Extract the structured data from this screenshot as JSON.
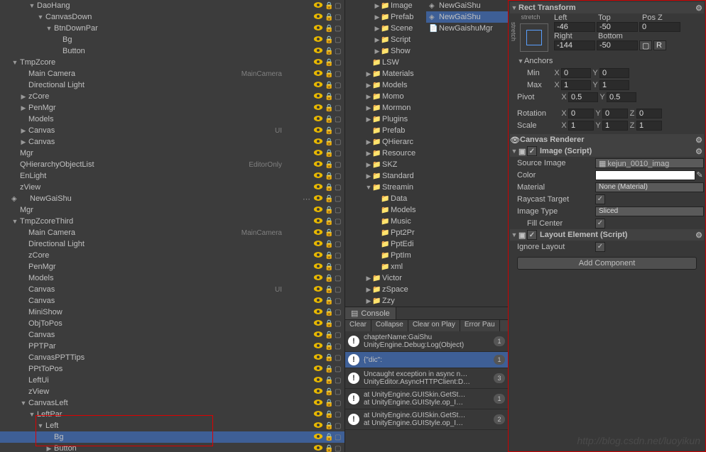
{
  "hierarchy": [
    {
      "ind": 3,
      "name": "DaoHang",
      "tri": "open",
      "eye": true
    },
    {
      "ind": 4,
      "name": "CanvasDown",
      "tri": "open",
      "eye": true
    },
    {
      "ind": 5,
      "name": "BtnDownPar",
      "tri": "open",
      "eye": true
    },
    {
      "ind": 6,
      "name": "Bg",
      "eye": true
    },
    {
      "ind": 6,
      "name": "Button",
      "eye": true
    },
    {
      "ind": 1,
      "name": "TmpZcore",
      "tri": "open",
      "eye": true
    },
    {
      "ind": 2,
      "name": "Main Camera",
      "tag": "MainCamera",
      "eye": true
    },
    {
      "ind": 2,
      "name": "Directional Light",
      "eye": true
    },
    {
      "ind": 2,
      "name": "zCore",
      "tri": "closed",
      "eye": true
    },
    {
      "ind": 2,
      "name": "PenMgr",
      "tri": "closed",
      "eye": true
    },
    {
      "ind": 2,
      "name": "Models",
      "eye": true
    },
    {
      "ind": 2,
      "name": "Canvas",
      "tag": "UI",
      "tri": "closed",
      "eye": true
    },
    {
      "ind": 2,
      "name": "Canvas",
      "tri": "closed",
      "eye": true
    },
    {
      "ind": 1,
      "name": "Mgr",
      "eye": true
    },
    {
      "ind": 1,
      "name": "QHierarchyObjectList",
      "tag": "EditorOnly",
      "eye": true
    },
    {
      "ind": 1,
      "name": "EnLight",
      "eye": true
    },
    {
      "ind": 1,
      "name": "zView",
      "eye": true
    },
    {
      "ind": 1,
      "name": "NewGaiShu",
      "cube": true,
      "eye": true,
      "gear": true
    },
    {
      "ind": 1,
      "name": "Mgr",
      "eye": true
    },
    {
      "ind": 1,
      "name": "TmpZcoreThird",
      "tri": "open",
      "eye": true
    },
    {
      "ind": 2,
      "name": "Main Camera",
      "tag": "MainCamera",
      "eye": true
    },
    {
      "ind": 2,
      "name": "Directional Light",
      "eye": true
    },
    {
      "ind": 2,
      "name": "zCore",
      "eye": true
    },
    {
      "ind": 2,
      "name": "PenMgr",
      "eye": true
    },
    {
      "ind": 2,
      "name": "Models",
      "eye": true
    },
    {
      "ind": 2,
      "name": "Canvas",
      "tag": "UI",
      "eye": true
    },
    {
      "ind": 2,
      "name": "Canvas",
      "eye": true
    },
    {
      "ind": 2,
      "name": "MiniShow",
      "eye": true
    },
    {
      "ind": 2,
      "name": "ObjToPos",
      "eye": true
    },
    {
      "ind": 2,
      "name": "Canvas",
      "eye": true
    },
    {
      "ind": 2,
      "name": "PPTPar",
      "eye": true
    },
    {
      "ind": 2,
      "name": "CanvasPPTTips",
      "eye": true
    },
    {
      "ind": 2,
      "name": "PPtToPos",
      "eye": true
    },
    {
      "ind": 2,
      "name": "LeftUi",
      "eye": true
    },
    {
      "ind": 2,
      "name": "zView",
      "eye": true
    },
    {
      "ind": 2,
      "name": "CanvasLeft",
      "tri": "open",
      "eye": true
    },
    {
      "ind": 3,
      "name": "LeftPar",
      "tri": "open",
      "eye": true
    },
    {
      "ind": 4,
      "name": "Left",
      "tri": "open",
      "eye": true,
      "red": true
    },
    {
      "ind": 5,
      "name": "Bg",
      "sel": true,
      "eye": true,
      "red": true
    },
    {
      "ind": 5,
      "name": "Button",
      "tri": "closed",
      "eye": true
    }
  ],
  "project": [
    {
      "ind": 3,
      "name": "Image",
      "tri": "closed"
    },
    {
      "ind": 3,
      "name": "Prefab",
      "tri": "closed"
    },
    {
      "ind": 3,
      "name": "Scene",
      "tri": "closed"
    },
    {
      "ind": 3,
      "name": "Script",
      "tri": "closed"
    },
    {
      "ind": 3,
      "name": "Show",
      "tri": "closed"
    },
    {
      "ind": 2,
      "name": "LSW"
    },
    {
      "ind": 2,
      "name": "Materials",
      "tri": "closed"
    },
    {
      "ind": 2,
      "name": "Models",
      "tri": "closed"
    },
    {
      "ind": 2,
      "name": "Momo",
      "tri": "closed"
    },
    {
      "ind": 2,
      "name": "Mormon",
      "tri": "closed"
    },
    {
      "ind": 2,
      "name": "Plugins",
      "tri": "closed"
    },
    {
      "ind": 2,
      "name": "Prefab"
    },
    {
      "ind": 2,
      "name": "QHierarc",
      "tri": "closed"
    },
    {
      "ind": 2,
      "name": "Resource",
      "tri": "closed"
    },
    {
      "ind": 2,
      "name": "SKZ",
      "tri": "closed"
    },
    {
      "ind": 2,
      "name": "Standard",
      "tri": "closed"
    },
    {
      "ind": 2,
      "name": "Streamin",
      "tri": "open"
    },
    {
      "ind": 3,
      "name": "Data"
    },
    {
      "ind": 3,
      "name": "Models"
    },
    {
      "ind": 3,
      "name": "Music"
    },
    {
      "ind": 3,
      "name": "Ppt2Pr"
    },
    {
      "ind": 3,
      "name": "PptEdi"
    },
    {
      "ind": 3,
      "name": "PptIm"
    },
    {
      "ind": 3,
      "name": "xml"
    },
    {
      "ind": 2,
      "name": "Victor",
      "tri": "closed"
    },
    {
      "ind": 2,
      "name": "zSpace",
      "tri": "closed"
    },
    {
      "ind": 2,
      "name": "Zzy",
      "tri": "closed"
    }
  ],
  "prefab_panel": [
    {
      "name": "NewGaiShu",
      "cube": true
    },
    {
      "name": "NewGaiShu",
      "cube": true,
      "sel": true
    },
    {
      "name": "NewGaishuMgr",
      "cs": true
    }
  ],
  "inspector": {
    "rect": {
      "title": "Rect Transform",
      "stretch": "stretch",
      "left_lbl": "Left",
      "top_lbl": "Top",
      "posz_lbl": "Pos Z",
      "left": "-46",
      "top": "-50",
      "posz": "0",
      "right_lbl": "Right",
      "bottom_lbl": "Bottom",
      "right": "-144",
      "bottom": "-50",
      "anchors": "Anchors",
      "min": "Min",
      "max": "Max",
      "min_x": "0",
      "min_y": "0",
      "max_x": "1",
      "max_y": "1",
      "pivot": "Pivot",
      "piv_x": "0.5",
      "piv_y": "0.5",
      "rotation": "Rotation",
      "rx": "0",
      "ry": "0",
      "rz": "0",
      "scale": "Scale",
      "sx": "1",
      "sy": "1",
      "sz": "1"
    },
    "canvas_renderer": "Canvas Renderer",
    "image": {
      "title": "Image (Script)",
      "src_lbl": "Source Image",
      "src_val": "kejun_0010_imag",
      "color_lbl": "Color",
      "mat_lbl": "Material",
      "mat_val": "None (Material)",
      "ray_lbl": "Raycast Target",
      "type_lbl": "Image Type",
      "type_val": "Sliced",
      "fill_lbl": "Fill Center"
    },
    "layout": {
      "title": "Layout Element (Script)",
      "ignore_lbl": "Ignore Layout"
    },
    "add": "Add Component"
  },
  "console": {
    "tab": "Console",
    "buttons": {
      "clear": "Clear",
      "collapse": "Collapse",
      "cop": "Clear on Play",
      "err": "Error Pau"
    },
    "logs": [
      {
        "t1": "chapterName:GaiShu",
        "t2": "UnityEngine.Debug:Log(Object)",
        "b": "1"
      },
      {
        "t1": "{\"dic\":",
        "t2": "",
        "b": "1",
        "sel": true
      },
      {
        "t1": "Uncaught exception in async n…",
        "t2": "UnityEditor.AsyncHTTPClient:D…",
        "b": "3"
      },
      {
        "t1": "at UnityEngine.GUISkin.GetSt…",
        "t2": "at UnityEngine.GUIStyle.op_I…",
        "b": "1"
      },
      {
        "t1": "at UnityEngine.GUISkin.GetSt…",
        "t2": "at UnityEngine.GUIStyle.op_I…",
        "b": "2"
      }
    ]
  },
  "watermark": "http://blog.csdn.net/luoyikun"
}
